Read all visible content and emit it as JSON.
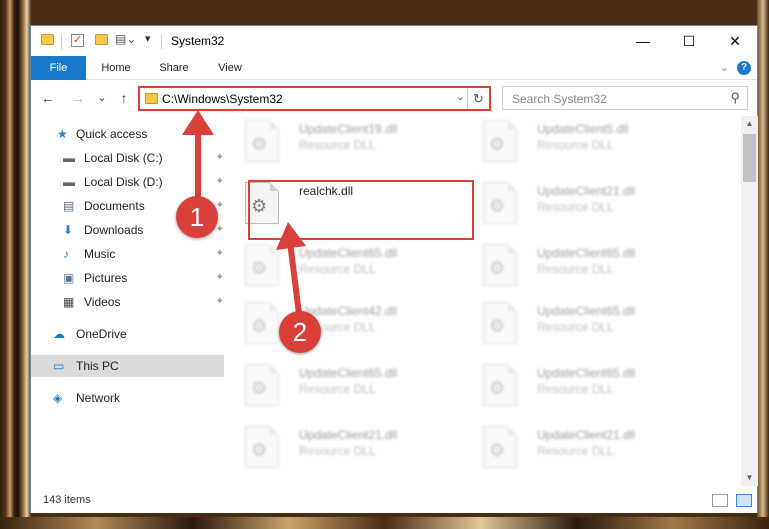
{
  "window": {
    "title": "System32",
    "controls": {
      "minimize": "—",
      "maximize": "☐",
      "close": "✕"
    }
  },
  "ribbon": {
    "tabs": [
      "File",
      "Home",
      "Share",
      "View"
    ],
    "expand_glyph": "⌄",
    "help_glyph": "?"
  },
  "nav": {
    "back": "←",
    "forward": "→",
    "recent": "⌄",
    "up": "↑",
    "address": "C:\\Windows\\System32",
    "address_dropdown": "⌄",
    "refresh": "↻",
    "search_placeholder": "Search System32",
    "search_glyph": "⚲"
  },
  "sidebar": {
    "items": [
      {
        "label": "Quick access",
        "icon": "star-icon",
        "glyph": "★",
        "pinned": false
      },
      {
        "label": "Local Disk (C:)",
        "icon": "drive-icon",
        "glyph": "▬",
        "pinned": true
      },
      {
        "label": "Local Disk (D:)",
        "icon": "drive-icon",
        "glyph": "▬",
        "pinned": true
      },
      {
        "label": "Documents",
        "icon": "documents-icon",
        "glyph": "▤",
        "pinned": true
      },
      {
        "label": "Downloads",
        "icon": "download-icon",
        "glyph": "⬇",
        "pinned": true
      },
      {
        "label": "Music",
        "icon": "music-icon",
        "glyph": "♪",
        "pinned": true
      },
      {
        "label": "Pictures",
        "icon": "pictures-icon",
        "glyph": "▣",
        "pinned": true
      },
      {
        "label": "Videos",
        "icon": "videos-icon",
        "glyph": "▦",
        "pinned": true
      },
      {
        "label": "OneDrive",
        "icon": "cloud-icon",
        "glyph": "☁",
        "pinned": false
      },
      {
        "label": "This PC",
        "icon": "computer-icon",
        "glyph": "▭",
        "pinned": false,
        "selected": true
      },
      {
        "label": "Network",
        "icon": "network-icon",
        "glyph": "◈",
        "pinned": false
      }
    ],
    "pin_glyph": "📌"
  },
  "files": [
    {
      "name": "UpdateClient19.dll",
      "type": "Resource DLL",
      "blurred": true
    },
    {
      "name": "UpdateClient5.dll",
      "type": "Resource DLL",
      "blurred": true
    },
    {
      "name": "realchk.dll",
      "type": "",
      "blurred": false,
      "highlighted": true
    },
    {
      "name": "UpdateClient21.dll",
      "type": "Resource DLL",
      "blurred": true
    },
    {
      "name": "UpdateClient65.dll",
      "type": "Resource DLL",
      "blurred": true
    },
    {
      "name": "UpdateClient65.dll",
      "type": "Resource DLL",
      "blurred": true
    },
    {
      "name": "UpdateClient42.dll",
      "type": "Resource DLL",
      "blurred": true
    },
    {
      "name": "UpdateClient65.dll",
      "type": "Resource DLL",
      "blurred": true
    },
    {
      "name": "UpdateClient65.dll",
      "type": "Resource DLL",
      "blurred": true
    },
    {
      "name": "UpdateClient65.dll",
      "type": "Resource DLL",
      "blurred": true
    },
    {
      "name": "UpdateClient21.dll",
      "type": "Resource DLL",
      "blurred": true
    },
    {
      "name": "UpdateClient21.dll",
      "type": "Resource DLL",
      "blurred": true
    }
  ],
  "gear_glyph": "⚙",
  "status": {
    "item_count": "143 items"
  },
  "annotations": {
    "step1": "1",
    "step2": "2",
    "color": "#d9403a"
  }
}
